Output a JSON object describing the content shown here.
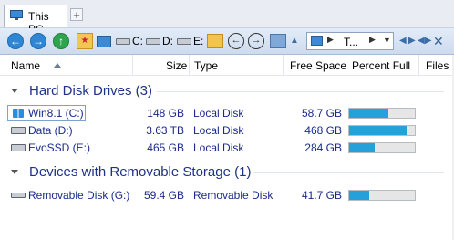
{
  "tab": {
    "label": "This PC",
    "icon": "computer-icon",
    "new_tab": "+"
  },
  "toolbar": {
    "drives": [
      {
        "label": "C:",
        "icon": "drive-icon"
      },
      {
        "label": "D:",
        "icon": "drive-icon"
      },
      {
        "label": "E:",
        "icon": "drive-icon"
      }
    ],
    "path": {
      "text": "T...",
      "icon": "computer-icon"
    }
  },
  "columns": {
    "name": "Name",
    "size": "Size",
    "type": "Type",
    "free_space": "Free Space",
    "percent_full": "Percent Full",
    "files": "Files"
  },
  "groups": [
    {
      "title": "Hard Disk Drives (3)",
      "items": [
        {
          "name": "Win8.1 (C:)",
          "size": "148 GB",
          "type": "Local Disk",
          "free": "58.7 GB",
          "percent_full": 0.6,
          "icon": "windows-drive-icon"
        },
        {
          "name": "Data (D:)",
          "size": "3.63 TB",
          "type": "Local Disk",
          "free": "468 GB",
          "percent_full": 0.87,
          "icon": "hard-drive-icon"
        },
        {
          "name": "EvoSSD (E:)",
          "size": "465 GB",
          "type": "Local Disk",
          "free": "284 GB",
          "percent_full": 0.39,
          "icon": "hard-drive-icon"
        }
      ]
    },
    {
      "title": "Devices with Removable Storage (1)",
      "items": [
        {
          "name": "Removable Disk (G:)",
          "size": "59.4 GB",
          "type": "Removable Disk",
          "free": "41.7 GB",
          "percent_full": 0.3,
          "icon": "removable-drive-icon"
        }
      ]
    }
  ],
  "colors": {
    "accent": "#26a0da",
    "group_title": "#1e3287",
    "row_text": "#1a2a8a"
  }
}
